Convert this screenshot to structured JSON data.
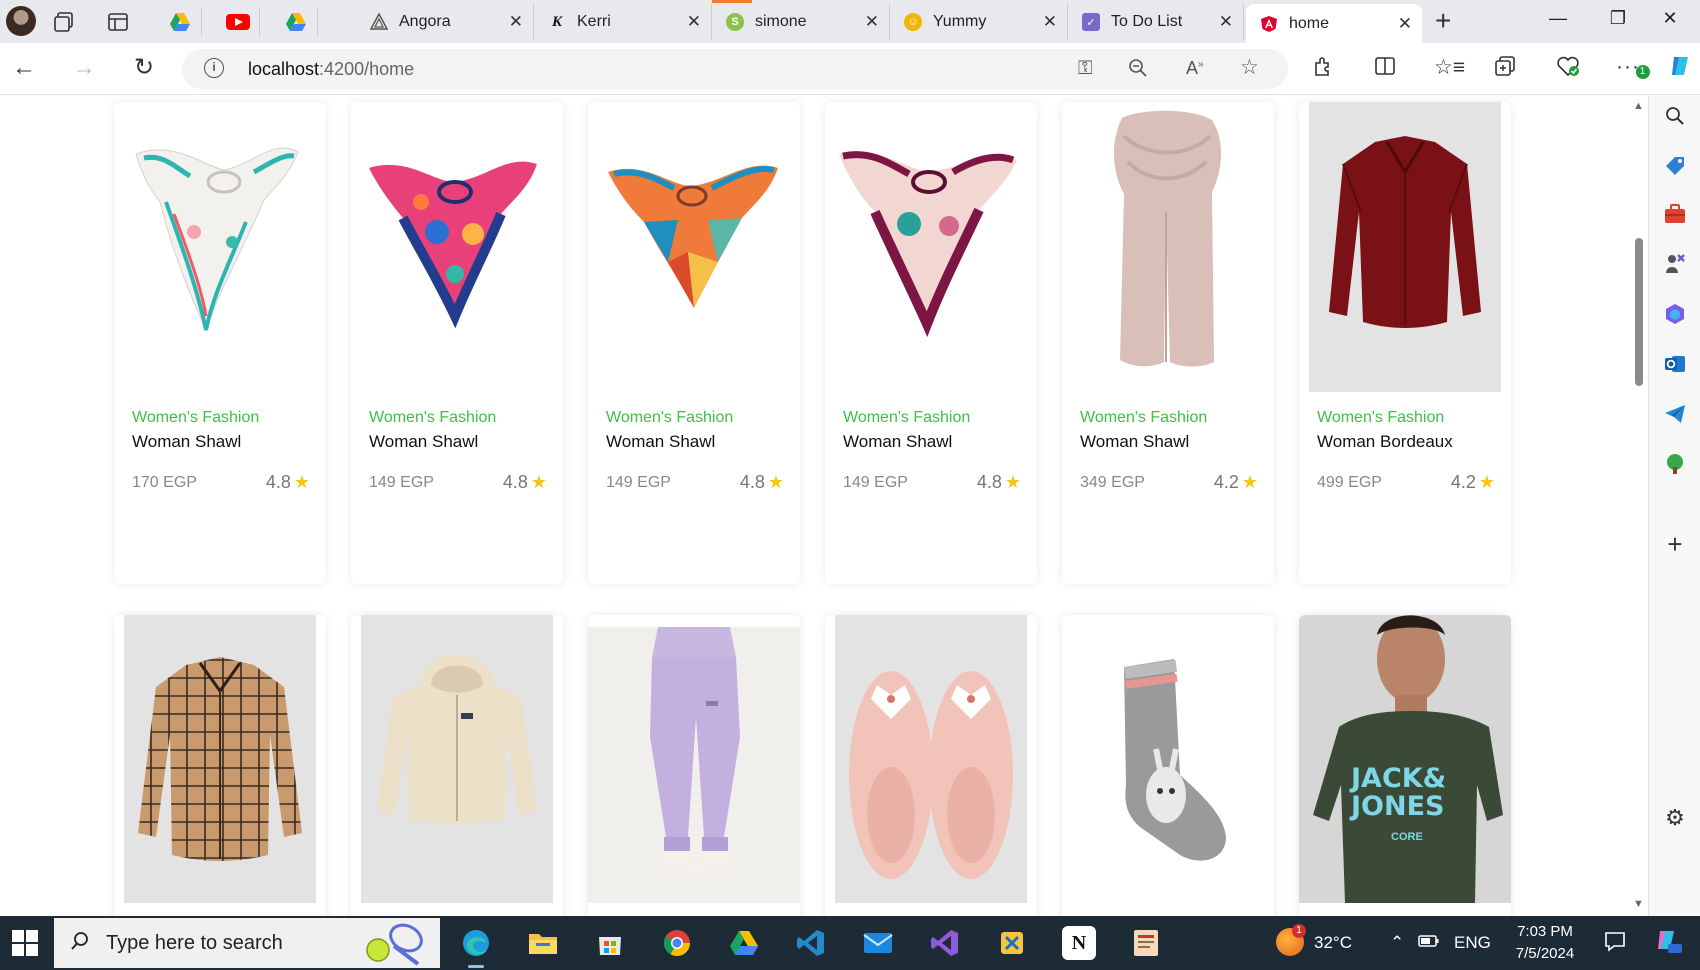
{
  "browser": {
    "pinned_tabs": [
      "google-drive",
      "youtube",
      "google-drive"
    ],
    "tabs": [
      {
        "title": "Angora",
        "favicon_color": "#6f6f6f",
        "favicon_glyph": "A"
      },
      {
        "title": "Kerri",
        "favicon_color": "#222222",
        "favicon_glyph": "K"
      },
      {
        "title": "simone",
        "favicon_color": "#8bc34a",
        "favicon_glyph": "S"
      },
      {
        "title": "Yummy",
        "favicon_color": "#f2b705",
        "favicon_glyph": "Y"
      },
      {
        "title": "To Do List",
        "favicon_color": "#7b68c9",
        "favicon_glyph": "T"
      },
      {
        "title": "home",
        "favicon_color": "#dd0031",
        "favicon_glyph": "A"
      }
    ],
    "address": {
      "host": "localhost",
      "path": ":4200/home"
    },
    "notification_badge": "1"
  },
  "products_row1": [
    {
      "category": "Women's Fashion",
      "name": "Woman Shawl",
      "price": "170 EGP",
      "rating": "4.8"
    },
    {
      "category": "Women's Fashion",
      "name": "Woman Shawl",
      "price": "149 EGP",
      "rating": "4.8"
    },
    {
      "category": "Women's Fashion",
      "name": "Woman Shawl",
      "price": "149 EGP",
      "rating": "4.8"
    },
    {
      "category": "Women's Fashion",
      "name": "Woman Shawl",
      "price": "149 EGP",
      "rating": "4.8"
    },
    {
      "category": "Women's Fashion",
      "name": "Woman Shawl",
      "price": "349 EGP",
      "rating": "4.2"
    },
    {
      "category": "Women's Fashion",
      "name": "Woman Bordeaux",
      "price": "499 EGP",
      "rating": "4.2"
    }
  ],
  "products_row2": [
    {
      "image": "plaid-shirt"
    },
    {
      "image": "cream-hoodie"
    },
    {
      "image": "lilac-sweatpants"
    },
    {
      "image": "bunny-slippers"
    },
    {
      "image": "grey-sock"
    },
    {
      "image": "man-tshirt",
      "print": "JACK& JONES",
      "print_sub": "CORE"
    }
  ],
  "colors": {
    "accent_green": "#3fbf48",
    "star": "#f5c518",
    "taskbar": "#1c2b36"
  },
  "taskbar": {
    "search_placeholder": "Type here to search",
    "weather": "32°C",
    "weather_badge": "1",
    "language": "ENG",
    "time": "7:03 PM",
    "date": "7/5/2024"
  }
}
